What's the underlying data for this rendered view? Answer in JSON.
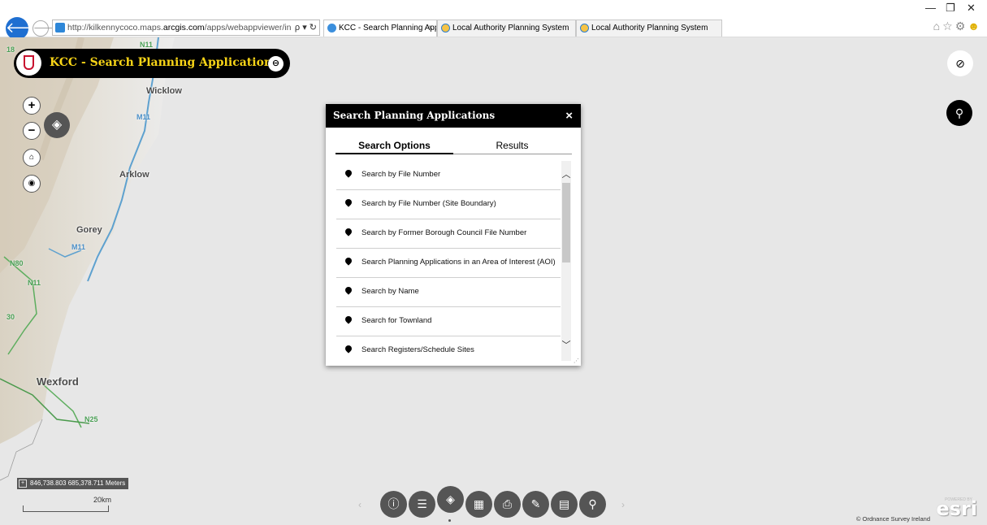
{
  "browser": {
    "url_prefix": "http://kilkennycoco.maps.",
    "url_host": "arcgis.com",
    "url_rest": "/apps/webappviewer/inde›",
    "url_tools": "ρ ▾ ↻",
    "tabs": [
      {
        "label": "KCC - Search Planning Appl...",
        "close": "×"
      },
      {
        "label": "Local Authority Planning System"
      },
      {
        "label": "Local Authority Planning System"
      }
    ],
    "window_controls": {
      "minimize": "—",
      "restore": "❐",
      "close": "✕"
    },
    "icons": [
      "home-icon",
      "star-icon",
      "gear-icon",
      "smiley-icon"
    ]
  },
  "app": {
    "title": "KCC - Search Planning Applications",
    "link_icon": "link-icon"
  },
  "map": {
    "places": [
      "Wicklow",
      "Arklow",
      "Gorey",
      "Wexford"
    ],
    "roads": [
      "N11",
      "M11",
      "M11",
      "N80",
      "N11",
      "N25",
      "30",
      "18"
    ],
    "coordinates": "846,738.803 685,378.711 Meters",
    "scale_label": "20km",
    "attribution": "© Ordnance Survey Ireland",
    "esri_powered": "POWERED BY",
    "esri_brand": "esri"
  },
  "panel": {
    "title": "Search Planning Applications",
    "close": "×",
    "tabs": [
      "Search Options",
      "Results"
    ],
    "items": [
      "Search by File Number",
      "Search by File Number (Site Boundary)",
      "Search by Former Borough Council File Number",
      "Search Planning Applications in an Area of Interest (AOI)",
      "Search by Name",
      "Search for Townland",
      "Search Registers/Schedule Sites"
    ]
  },
  "toolbar": {
    "buttons": [
      "info-icon",
      "legend-icon",
      "layers-icon",
      "basemap-icon",
      "print-icon",
      "measure-icon",
      "attribute-table-icon",
      "search-icon"
    ]
  }
}
